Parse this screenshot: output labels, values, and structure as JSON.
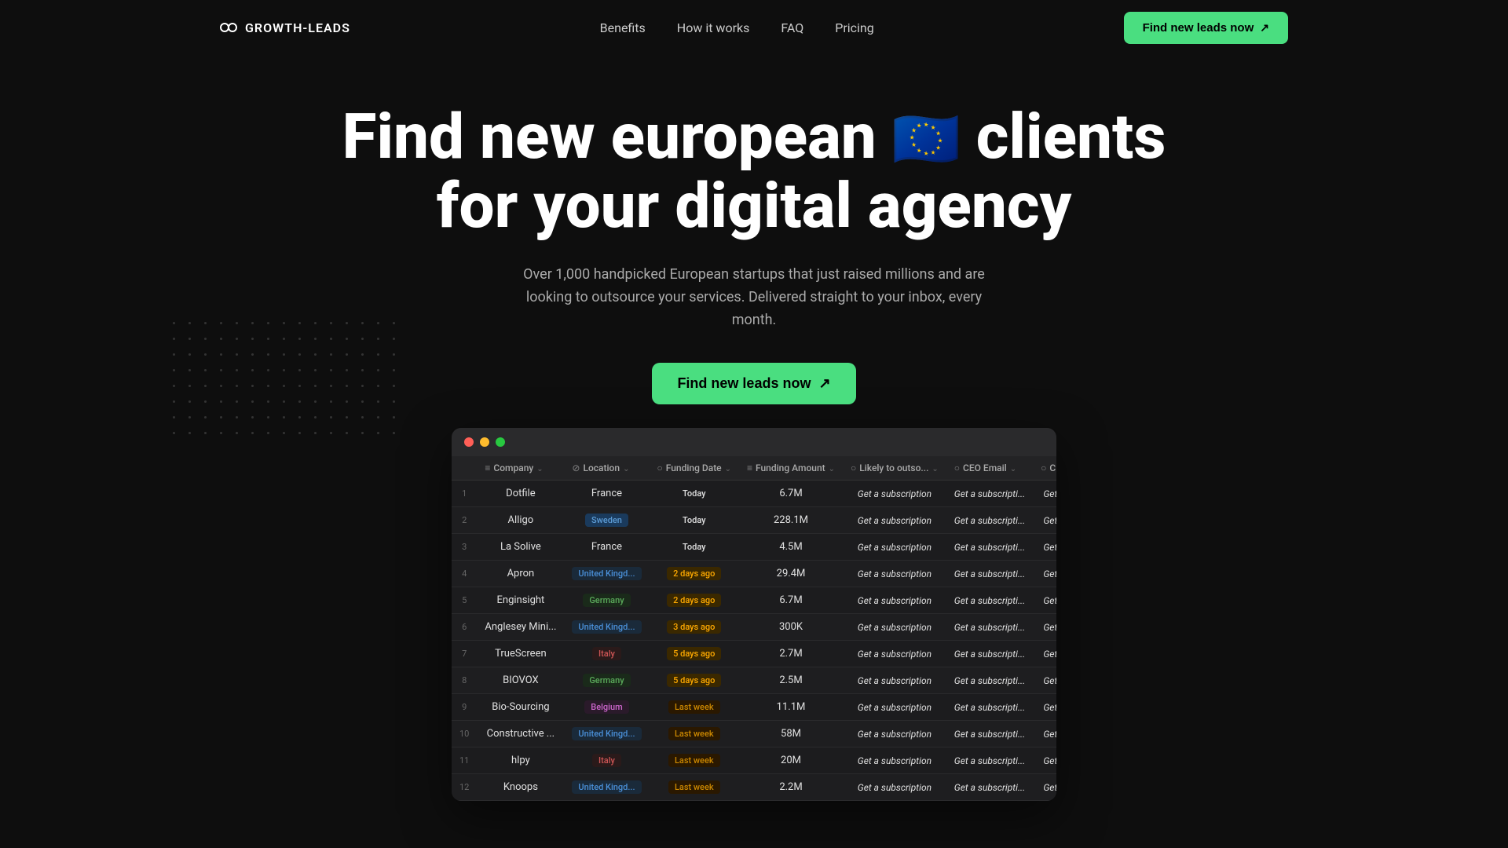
{
  "nav": {
    "logo_text": "GROWTH-LEADS",
    "links": [
      {
        "label": "Benefits",
        "href": "#"
      },
      {
        "label": "How it works",
        "href": "#"
      },
      {
        "label": "FAQ",
        "href": "#"
      },
      {
        "label": "Pricing",
        "href": "#"
      }
    ],
    "cta_label": "Find new leads now"
  },
  "hero": {
    "headline_part1": "Find new european",
    "eu_flag": "🇪🇺",
    "headline_part2": "clients",
    "headline_line2": "for your digital agency",
    "subtext": "Over 1,000 handpicked European startups that just raised millions and are looking to outsource your services. Delivered straight to your inbox, every month.",
    "cta_label": "Find new leads now"
  },
  "table": {
    "headers": [
      {
        "label": "Company",
        "icon": "≡"
      },
      {
        "label": "Location",
        "icon": "⊘"
      },
      {
        "label": "Funding Date",
        "icon": "○"
      },
      {
        "label": "Funding Amount",
        "icon": "≡"
      },
      {
        "label": "Likely to outso...",
        "icon": "○"
      },
      {
        "label": "CEO Email",
        "icon": "○"
      },
      {
        "label": "CEO Phone ...",
        "icon": "○"
      }
    ],
    "rows": [
      {
        "num": 1,
        "company": "Dotfile",
        "location": "France",
        "location_type": "plain",
        "funding_date": "Today",
        "date_type": "today",
        "amount": "6.7M"
      },
      {
        "num": 2,
        "company": "Alligo",
        "location": "Sweden",
        "location_type": "sweden",
        "funding_date": "Today",
        "date_type": "today",
        "amount": "228.1M"
      },
      {
        "num": 3,
        "company": "La Solive",
        "location": "France",
        "location_type": "plain",
        "funding_date": "Today",
        "date_type": "today",
        "amount": "4.5M"
      },
      {
        "num": 4,
        "company": "Apron",
        "location": "United Kingd...",
        "location_type": "uk",
        "funding_date": "2 days ago",
        "date_type": "2days",
        "amount": "29.4M"
      },
      {
        "num": 5,
        "company": "Enginsight",
        "location": "Germany",
        "location_type": "germany",
        "funding_date": "2 days ago",
        "date_type": "2days",
        "amount": "6.7M"
      },
      {
        "num": 6,
        "company": "Anglesey Mini...",
        "location": "United Kingd...",
        "location_type": "uk",
        "funding_date": "3 days ago",
        "date_type": "3days",
        "amount": "300K"
      },
      {
        "num": 7,
        "company": "TrueScreen",
        "location": "Italy",
        "location_type": "italy",
        "funding_date": "5 days ago",
        "date_type": "5days",
        "amount": "2.7M"
      },
      {
        "num": 8,
        "company": "BIOVOX",
        "location": "Germany",
        "location_type": "germany",
        "funding_date": "5 days ago",
        "date_type": "5days",
        "amount": "2.5M"
      },
      {
        "num": 9,
        "company": "Bio-Sourcing",
        "location": "Belgium",
        "location_type": "belgium",
        "funding_date": "Last week",
        "date_type": "lastweek",
        "amount": "11.1M"
      },
      {
        "num": 10,
        "company": "Constructive ...",
        "location": "United Kingd...",
        "location_type": "uk",
        "funding_date": "Last week",
        "date_type": "lastweek",
        "amount": "58M"
      },
      {
        "num": 11,
        "company": "hlpy",
        "location": "Italy",
        "location_type": "italy",
        "funding_date": "Last week",
        "date_type": "lastweek",
        "amount": "20M"
      },
      {
        "num": 12,
        "company": "Knoops",
        "location": "United Kingd...",
        "location_type": "uk",
        "funding_date": "Last week",
        "date_type": "lastweek",
        "amount": "2.2M"
      }
    ],
    "sub_cell_text": "Get a subscription",
    "sub_cell_short": "Get a subscripti...",
    "sub_cell_shorter": "Get a subscripti..."
  }
}
